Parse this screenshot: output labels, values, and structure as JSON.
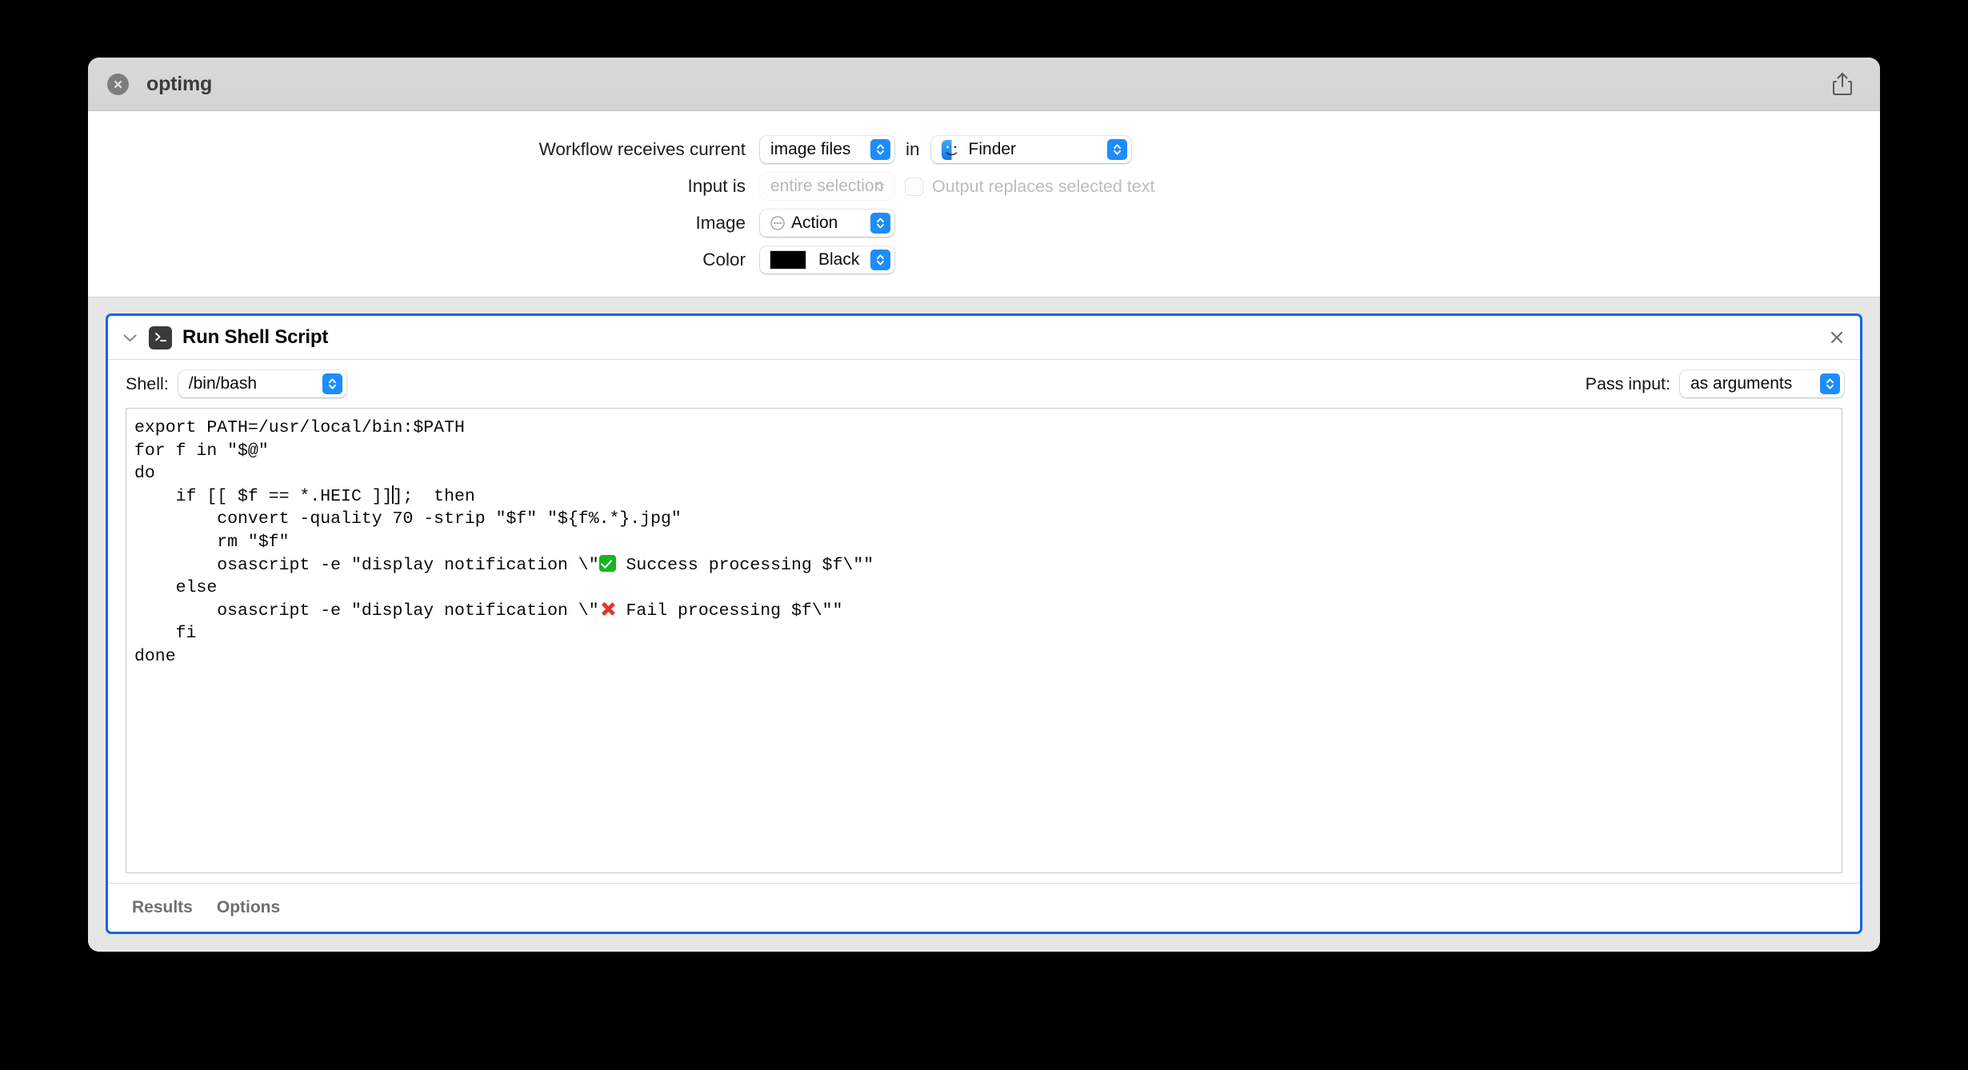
{
  "window": {
    "title": "optimg",
    "close_icon": "close-circle-icon",
    "share_icon": "share-icon"
  },
  "settings": {
    "rows": [
      {
        "label": "Workflow receives current",
        "value": "image files",
        "conjunction": "in",
        "app_value": "Finder",
        "app_icon": "finder-icon"
      },
      {
        "label": "Input is",
        "value": "entire selection",
        "disabled": true,
        "checkbox_label": "Output replaces selected text",
        "checkbox_checked": false
      },
      {
        "label": "Image",
        "value": "Action",
        "icon": "action-ellipsis-icon"
      },
      {
        "label": "Color",
        "value": "Black",
        "swatch_hex": "#000000"
      }
    ]
  },
  "action": {
    "title": "Run Shell Script",
    "icon": "terminal-icon",
    "disclosure_icon": "chevron-down-icon",
    "close_icon": "close-x-icon",
    "shell_label": "Shell:",
    "shell_value": "/bin/bash",
    "pass_input_label": "Pass input:",
    "pass_input_value": "as arguments",
    "script_lines": [
      "export PATH=/usr/local/bin:$PATH",
      "for f in \"$@\"",
      "do",
      "    if [[ $f == *.HEIC ]];  then",
      "        convert -quality 70 -strip \"$f\" \"${f%.*}.jpg\"",
      "        rm \"$f\"",
      "        osascript -e \"display notification \\\"✅ Success processing $f\\\"\"",
      "    else",
      "        osascript -e \"display notification \\\"❌ Fail processing $f\\\"\"",
      "    fi",
      "done"
    ],
    "tabs": [
      {
        "label": "Results"
      },
      {
        "label": "Options"
      }
    ]
  },
  "colors": {
    "accent_blue": "#0a68e0",
    "stepper_blue": "#1d8cfc",
    "canvas_gray": "#e6e6e6",
    "titlebar_gray": "#d6d6d6",
    "success_green": "#19b324",
    "fail_red": "#e3342b"
  }
}
